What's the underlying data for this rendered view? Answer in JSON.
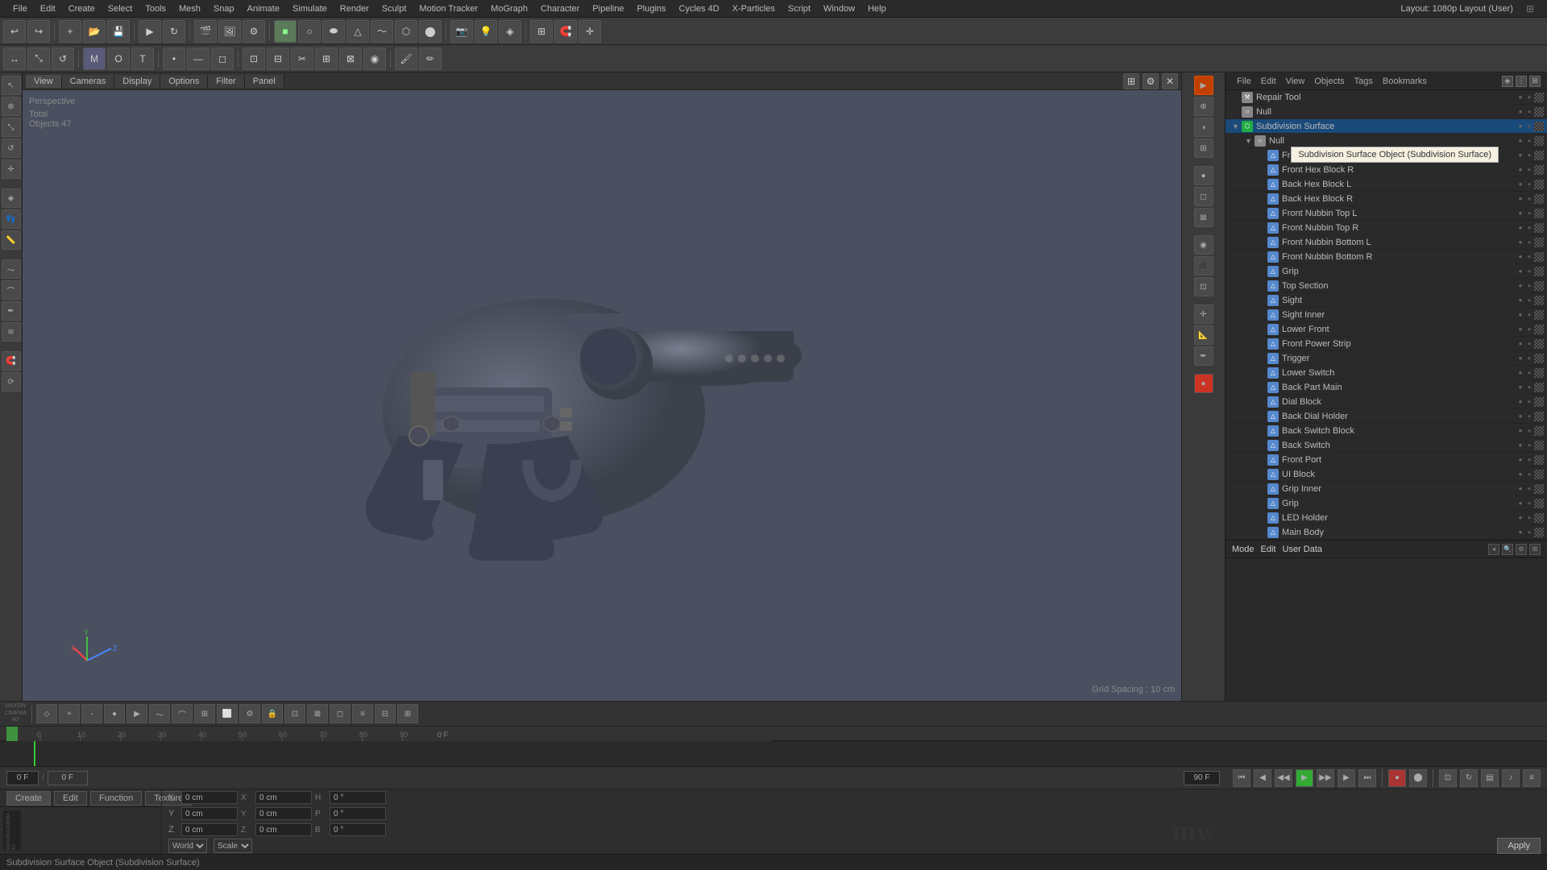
{
  "app": {
    "title": "Cinema 4D",
    "layout_label": "Layout: 1080p Layout (User)"
  },
  "menu": {
    "items": [
      "File",
      "Edit",
      "Create",
      "Select",
      "Tools",
      "Mesh",
      "Snap",
      "Animate",
      "Simulate",
      "Render",
      "Sculpt",
      "Motion Tracker",
      "MoGraph",
      "Character",
      "Pipeline",
      "Plugins",
      "Cycles 4D",
      "X-Particles",
      "Script",
      "Window",
      "Help"
    ]
  },
  "viewport": {
    "mode": "Perspective",
    "tabs": [
      "View",
      "Cameras",
      "Display",
      "Options",
      "Filter",
      "Panel"
    ],
    "total_label": "Total",
    "objects_label": "Objects",
    "objects_count": "47",
    "grid_spacing": "Grid Spacing : 10 cm"
  },
  "object_tree": {
    "tooltip": "Subdivision Surface Object (Subdivision Surface)",
    "items": [
      {
        "name": "Repair Tool",
        "indent": 0,
        "type": "null",
        "icon": "⚒"
      },
      {
        "name": "Null",
        "indent": 0,
        "type": "null",
        "icon": "○"
      },
      {
        "name": "Subdivision Surface",
        "indent": 0,
        "type": "subdiv",
        "icon": "⬡",
        "selected": true
      },
      {
        "name": "Null",
        "indent": 1,
        "type": "null",
        "icon": "○"
      },
      {
        "name": "Front Hex Block L",
        "indent": 2,
        "type": "mesh",
        "icon": "△"
      },
      {
        "name": "Front Hex Block R",
        "indent": 2,
        "type": "mesh",
        "icon": "△"
      },
      {
        "name": "Back Hex Block L",
        "indent": 2,
        "type": "mesh",
        "icon": "△"
      },
      {
        "name": "Back Hex Block R",
        "indent": 2,
        "type": "mesh",
        "icon": "△"
      },
      {
        "name": "Front Nubbin Top L",
        "indent": 2,
        "type": "mesh",
        "icon": "△"
      },
      {
        "name": "Front Nubbin Top R",
        "indent": 2,
        "type": "mesh",
        "icon": "△"
      },
      {
        "name": "Front Nubbin Bottom L",
        "indent": 2,
        "type": "mesh",
        "icon": "△"
      },
      {
        "name": "Front Nubbin Bottom R",
        "indent": 2,
        "type": "mesh",
        "icon": "△"
      },
      {
        "name": "Grip",
        "indent": 2,
        "type": "mesh",
        "icon": "△"
      },
      {
        "name": "Top Section",
        "indent": 2,
        "type": "mesh",
        "icon": "△"
      },
      {
        "name": "Sight",
        "indent": 2,
        "type": "mesh",
        "icon": "△"
      },
      {
        "name": "Sight Inner",
        "indent": 2,
        "type": "mesh",
        "icon": "△"
      },
      {
        "name": "Lower Front",
        "indent": 2,
        "type": "mesh",
        "icon": "△"
      },
      {
        "name": "Front Power Strip",
        "indent": 2,
        "type": "mesh",
        "icon": "△"
      },
      {
        "name": "Trigger",
        "indent": 2,
        "type": "mesh",
        "icon": "△"
      },
      {
        "name": "Lower Switch",
        "indent": 2,
        "type": "mesh",
        "icon": "△"
      },
      {
        "name": "Back Part Main",
        "indent": 2,
        "type": "mesh",
        "icon": "△"
      },
      {
        "name": "Dial Block",
        "indent": 2,
        "type": "mesh",
        "icon": "△"
      },
      {
        "name": "Back Dial Holder",
        "indent": 2,
        "type": "mesh",
        "icon": "△"
      },
      {
        "name": "Back Switch Block",
        "indent": 2,
        "type": "mesh",
        "icon": "△"
      },
      {
        "name": "Back Switch",
        "indent": 2,
        "type": "mesh",
        "icon": "△"
      },
      {
        "name": "Front Port",
        "indent": 2,
        "type": "mesh",
        "icon": "△"
      },
      {
        "name": "UI Block",
        "indent": 2,
        "type": "mesh",
        "icon": "△"
      },
      {
        "name": "Grip Inner",
        "indent": 2,
        "type": "mesh",
        "icon": "△"
      },
      {
        "name": "Grip",
        "indent": 2,
        "type": "mesh",
        "icon": "△"
      },
      {
        "name": "LED Holder",
        "indent": 2,
        "type": "mesh",
        "icon": "△"
      },
      {
        "name": "Main Body",
        "indent": 2,
        "type": "mesh",
        "icon": "△"
      }
    ]
  },
  "panel_tabs": [
    "File",
    "Edit",
    "View",
    "Objects",
    "Tags",
    "Bookmarks"
  ],
  "properties": {
    "tabs": [
      "Mode",
      "Edit",
      "User Data"
    ]
  },
  "coordinates": {
    "x_label": "X",
    "y_label": "Y",
    "z_label": "Z",
    "x_val": "0 cm",
    "y_val": "0 cm",
    "z_val": "0 cm",
    "x2_val": "0 cm",
    "y2_val": "0 cm",
    "z2_val": "0 cm",
    "h_label": "H",
    "p_label": "P",
    "b_label": "B",
    "h_val": "0 °",
    "p_val": "0 °",
    "b_val": "0 °",
    "world_label": "World",
    "scale_label": "Scale",
    "apply_label": "Apply"
  },
  "timeline": {
    "frame_start": "0 F",
    "frame_end": "90 F",
    "current_frame": "0 F",
    "fps_label": "0 F"
  },
  "bottom_tabs": [
    "Create",
    "Edit",
    "Function",
    "Texture"
  ],
  "status": {
    "text": "Subdivision Surface Object (Subdivision Surface)"
  },
  "logo": {
    "c4d": "MAXON\nCINEMA 4D",
    "mu": "mw"
  }
}
